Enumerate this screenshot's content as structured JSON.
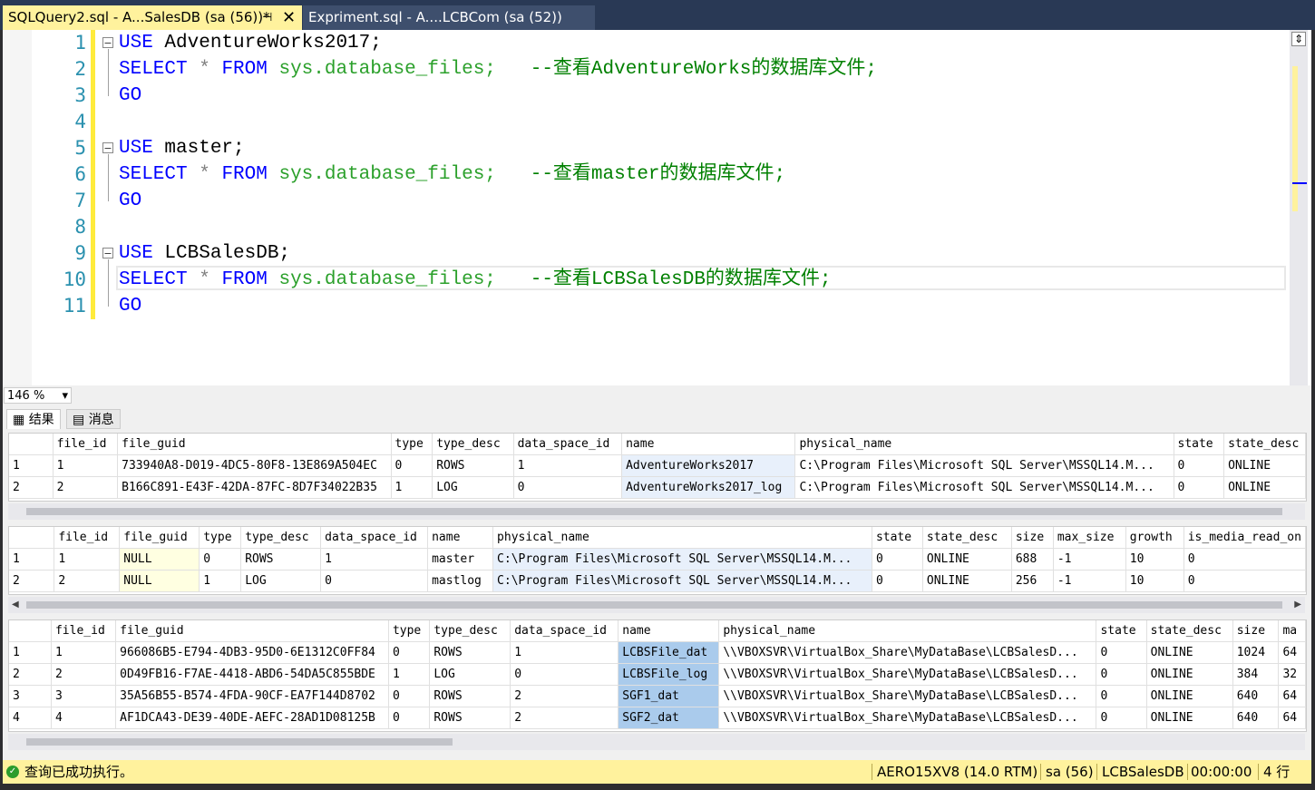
{
  "tabs": [
    {
      "label": "SQLQuery2.sql - A...SalesDB (sa (56))*",
      "pin": "⊣",
      "close": "✕"
    },
    {
      "label": "Expriment.sql - A....LCBCom (sa (52))"
    }
  ],
  "editor": {
    "line_numbers": [
      "1",
      "2",
      "3",
      "4",
      "5",
      "6",
      "7",
      "8",
      "9",
      "10",
      "11"
    ],
    "lines": [
      {
        "kw1": "USE",
        "rest": " AdventureWorks2017;"
      },
      {
        "kw1": "SELECT",
        "star": " * ",
        "kw2": "FROM",
        "sys": " sys.database_files;",
        "comment": "   --查看AdventureWorks的数据库文件;"
      },
      {
        "kw1": "GO"
      },
      {},
      {
        "kw1": "USE",
        "rest": " master;"
      },
      {
        "kw1": "SELECT",
        "star": " * ",
        "kw2": "FROM",
        "sys": " sys.database_files;",
        "comment": "   --查看master的数据库文件;"
      },
      {
        "kw1": "GO"
      },
      {},
      {
        "kw1": "USE",
        "rest": " LCBSalesDB;"
      },
      {
        "kw1": "SELECT",
        "star": " * ",
        "kw2": "FROM",
        "sys": " sys.database_files;",
        "comment": "   --查看LCBSalesDB的数据库文件;"
      },
      {
        "kw1": "GO"
      }
    ],
    "fold_symbol": "−"
  },
  "zoom": {
    "value": "146 %",
    "arrow": "▾"
  },
  "result_tabs": {
    "results": "结果",
    "messages": "消息"
  },
  "grid1": {
    "columns": [
      "",
      "file_id",
      "file_guid",
      "type",
      "type_desc",
      "data_space_id",
      "name",
      "physical_name",
      "state",
      "state_desc"
    ],
    "rows": [
      [
        "1",
        "1",
        "733940A8-D019-4DC5-80F8-13E869A504EC",
        "0",
        "ROWS",
        "1",
        "AdventureWorks2017",
        "C:\\Program Files\\Microsoft SQL Server\\MSSQL14.M...",
        "0",
        "ONLINE"
      ],
      [
        "2",
        "2",
        "B166C891-E43F-42DA-87FC-8D7F34022B35",
        "1",
        "LOG",
        "0",
        "AdventureWorks2017_log",
        "C:\\Program Files\\Microsoft SQL Server\\MSSQL14.M...",
        "0",
        "ONLINE"
      ]
    ]
  },
  "grid2": {
    "columns": [
      "",
      "file_id",
      "file_guid",
      "type",
      "type_desc",
      "data_space_id",
      "name",
      "physical_name",
      "state",
      "state_desc",
      "size",
      "max_size",
      "growth",
      "is_media_read_on"
    ],
    "rows": [
      [
        "1",
        "1",
        "NULL",
        "0",
        "ROWS",
        "1",
        "master",
        "C:\\Program Files\\Microsoft SQL Server\\MSSQL14.M...",
        "0",
        "ONLINE",
        "688",
        "-1",
        "10",
        "0"
      ],
      [
        "2",
        "2",
        "NULL",
        "1",
        "LOG",
        "0",
        "mastlog",
        "C:\\Program Files\\Microsoft SQL Server\\MSSQL14.M...",
        "0",
        "ONLINE",
        "256",
        "-1",
        "10",
        "0"
      ]
    ]
  },
  "grid3": {
    "columns": [
      "",
      "file_id",
      "file_guid",
      "type",
      "type_desc",
      "data_space_id",
      "name",
      "physical_name",
      "state",
      "state_desc",
      "size",
      "ma"
    ],
    "rows": [
      [
        "1",
        "1",
        "966086B5-E794-4DB3-95D0-6E1312C0FF84",
        "0",
        "ROWS",
        "1",
        "LCBSFile_dat",
        "\\\\VBOXSVR\\VirtualBox_Share\\MyDataBase\\LCBSalesD...",
        "0",
        "ONLINE",
        "1024",
        "64"
      ],
      [
        "2",
        "2",
        "0D49FB16-F7AE-4418-ABD6-54DA5C855BDE",
        "1",
        "LOG",
        "0",
        "LCBSFile_log",
        "\\\\VBOXSVR\\VirtualBox_Share\\MyDataBase\\LCBSalesD...",
        "0",
        "ONLINE",
        "384",
        "32"
      ],
      [
        "3",
        "3",
        "35A56B55-B574-4FDA-90CF-EA7F144D8702",
        "0",
        "ROWS",
        "2",
        "SGF1_dat",
        "\\\\VBOXSVR\\VirtualBox_Share\\MyDataBase\\LCBSalesD...",
        "0",
        "ONLINE",
        "640",
        "64"
      ],
      [
        "4",
        "4",
        "AF1DCA43-DE39-40DE-AEFC-28AD1D08125B",
        "0",
        "ROWS",
        "2",
        "SGF2_dat",
        "\\\\VBOXSVR\\VirtualBox_Share\\MyDataBase\\LCBSalesD...",
        "0",
        "ONLINE",
        "640",
        "64"
      ]
    ]
  },
  "status": {
    "message": "查询已成功执行。",
    "server": "AERO15XV8 (14.0 RTM)",
    "user": "sa (56)",
    "database": "LCBSalesDB",
    "elapsed": "00:00:00",
    "rows": "4 行"
  },
  "colors": {
    "accent": "#fff29d",
    "tabbar": "#293955",
    "keyword": "#0000ff",
    "system": "#2ba02b",
    "comment": "#008000",
    "line_number": "#2b91af"
  }
}
